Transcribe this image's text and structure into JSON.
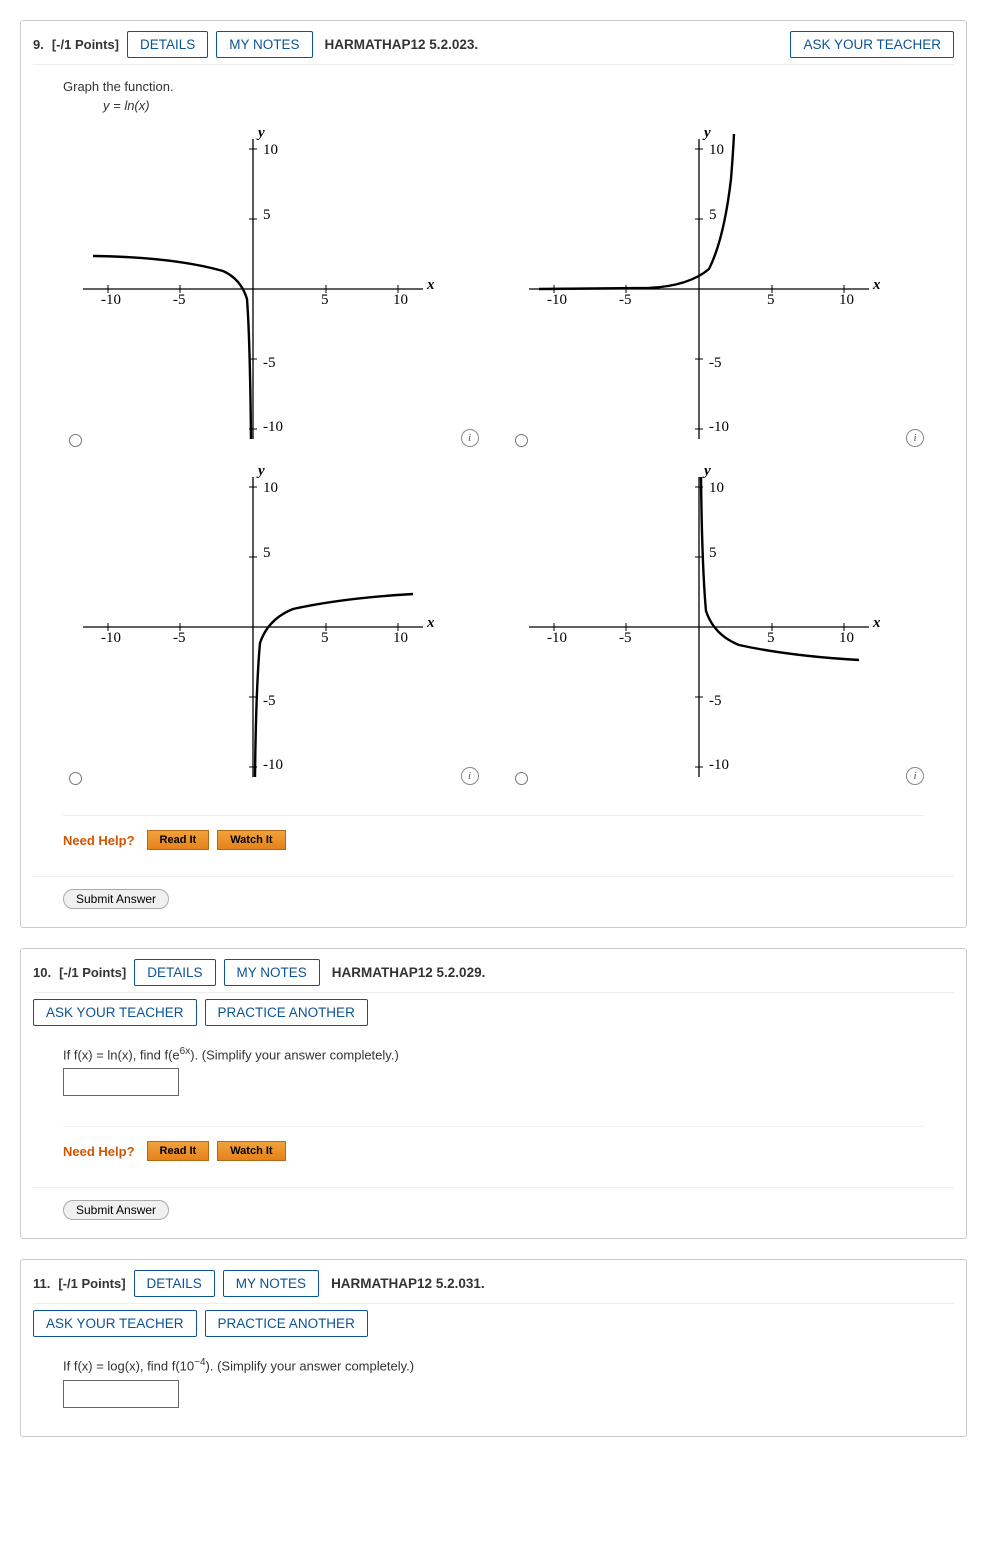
{
  "questions": [
    {
      "num": "9.",
      "points": "[-/1 Points]",
      "details": "DETAILS",
      "mynotes": "MY NOTES",
      "ref": "HARMATHAP12 5.2.023.",
      "ask": "ASK YOUR TEACHER",
      "instruction": "Graph the function.",
      "equation": "y = ln(x)",
      "help_label": "Need Help?",
      "read": "Read It",
      "watch": "Watch It",
      "submit": "Submit Answer"
    },
    {
      "num": "10.",
      "points": "[-/1 Points]",
      "details": "DETAILS",
      "mynotes": "MY NOTES",
      "ref": "HARMATHAP12 5.2.029.",
      "ask": "ASK YOUR TEACHER",
      "practice": "PRACTICE ANOTHER",
      "prompt_pre": "If f(x) = ln(x), find f(e",
      "prompt_sup": "6x",
      "prompt_post": "). (Simplify your answer completely.)",
      "help_label": "Need Help?",
      "read": "Read It",
      "watch": "Watch It",
      "submit": "Submit Answer"
    },
    {
      "num": "11.",
      "points": "[-/1 Points]",
      "details": "DETAILS",
      "mynotes": "MY NOTES",
      "ref": "HARMATHAP12 5.2.031.",
      "ask": "ASK YOUR TEACHER",
      "practice": "PRACTICE ANOTHER",
      "prompt_pre": "If f(x) = log(x), find f(10",
      "prompt_sup": "−4",
      "prompt_post": "). (Simplify your answer completely.)"
    }
  ],
  "chart_data": [
    {
      "type": "line",
      "title": "",
      "xlabel": "x",
      "ylabel": "y",
      "xlim": [
        -11,
        11
      ],
      "ylim": [
        -11,
        11
      ],
      "xticks": [
        -10,
        -5,
        5,
        10
      ],
      "yticks": [
        -10,
        -5,
        5,
        10
      ],
      "description": "y = ln(-x), reflected horizontally; passes through (-1,0) with vertical asymptote at x=0 going to -infinity as x->0-",
      "series": [
        {
          "name": "curve",
          "x": [
            -10,
            -5,
            -2,
            -1,
            -0.5,
            -0.2,
            -0.05
          ],
          "y": [
            2.3,
            1.6,
            0.7,
            0,
            -0.7,
            -1.6,
            -3
          ]
        }
      ]
    },
    {
      "type": "line",
      "title": "",
      "xlabel": "x",
      "ylabel": "y",
      "xlim": [
        -11,
        11
      ],
      "ylim": [
        -11,
        11
      ],
      "xticks": [
        -10,
        -5,
        5,
        10
      ],
      "yticks": [
        -10,
        -5,
        5,
        10
      ],
      "description": "y = e^x; horizontal asymptote y=0 on left, steep rise on right",
      "series": [
        {
          "name": "curve",
          "x": [
            -10,
            -5,
            -2,
            0,
            1,
            1.5,
            2,
            2.3,
            2.4
          ],
          "y": [
            0,
            0,
            0.14,
            1,
            2.7,
            4.5,
            7.4,
            10,
            11
          ]
        }
      ]
    },
    {
      "type": "line",
      "title": "",
      "xlabel": "x",
      "ylabel": "y",
      "xlim": [
        -11,
        11
      ],
      "ylim": [
        -11,
        11
      ],
      "xticks": [
        -10,
        -5,
        5,
        10
      ],
      "yticks": [
        -10,
        -5,
        5,
        10
      ],
      "description": "y = ln(x); correct answer; vertical asymptote at x=0 going to -infinity, passes (1,0)",
      "series": [
        {
          "name": "curve",
          "x": [
            0.05,
            0.2,
            0.5,
            1,
            2,
            5,
            10
          ],
          "y": [
            -3,
            -1.6,
            -0.7,
            0,
            0.7,
            1.6,
            2.3
          ]
        }
      ]
    },
    {
      "type": "line",
      "title": "",
      "xlabel": "x",
      "ylabel": "y",
      "xlim": [
        -11,
        11
      ],
      "ylim": [
        -11,
        11
      ],
      "xticks": [
        -10,
        -5,
        5,
        10
      ],
      "yticks": [
        -10,
        -5,
        5,
        10
      ],
      "description": "y = -ln(x); reflected vertically; vertical asymptote x=0 going to +infinity, passes (1,0) then decreasing",
      "series": [
        {
          "name": "curve",
          "x": [
            0.05,
            0.2,
            0.5,
            1,
            2,
            5,
            10
          ],
          "y": [
            3,
            1.6,
            0.7,
            0,
            -0.7,
            -1.6,
            -2.3
          ]
        }
      ]
    }
  ],
  "axis": {
    "x": "x",
    "y": "y",
    "ticks": [
      "-10",
      "-5",
      "5",
      "10",
      "-10",
      "-5",
      "5",
      "10"
    ]
  }
}
